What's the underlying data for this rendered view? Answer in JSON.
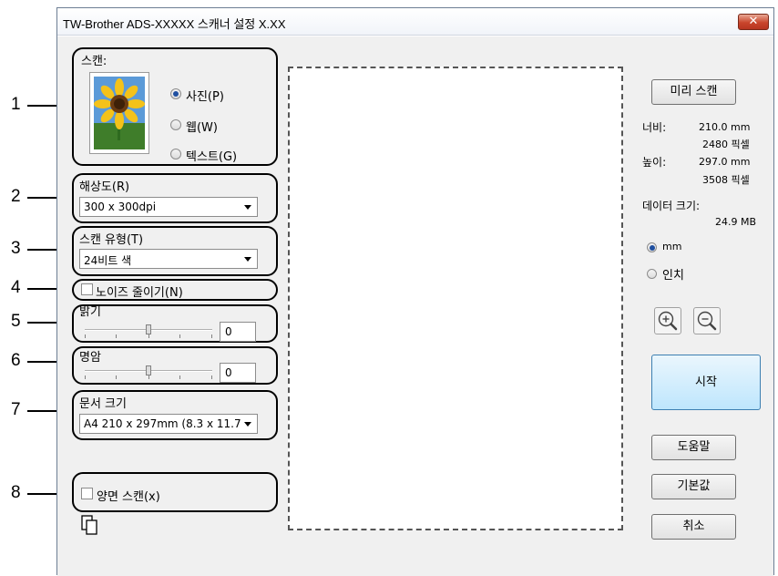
{
  "window": {
    "title": "TW-Brother ADS-XXXXX 스캐너 설정 X.XX",
    "close_glyph": "✕"
  },
  "callouts": [
    "1",
    "2",
    "3",
    "4",
    "5",
    "6",
    "7",
    "8"
  ],
  "scan_type_group": {
    "label": "스캔:",
    "options": [
      {
        "label": "사진(P)",
        "selected": true
      },
      {
        "label": "웹(W)",
        "selected": false
      },
      {
        "label": "텍스트(G)",
        "selected": false
      }
    ]
  },
  "resolution": {
    "label": "해상도(R)",
    "value": "300 x 300dpi"
  },
  "color_type": {
    "label": "스캔 유형(T)",
    "value": "24비트 색"
  },
  "noise_reduction": {
    "label": "노이즈 줄이기(N)",
    "checked": false
  },
  "brightness": {
    "label": "밝기",
    "value": "0",
    "level": 0
  },
  "contrast": {
    "label": "명암",
    "value": "0",
    "level": 0
  },
  "document_size": {
    "label": "문서 크기",
    "value": "A4 210 x 297mm (8.3 x 11.7"
  },
  "duplex": {
    "label": "양면 스캔(x)",
    "checked": false
  },
  "preview_button": "미리 스캔",
  "info": {
    "width_label": "너비:",
    "width_mm": "210.0 mm",
    "width_px": "2480 픽셀",
    "height_label": "높이:",
    "height_mm": "297.0 mm",
    "height_px": "3508 픽셀",
    "data_size_label": "데이터 크기:",
    "data_size_value": "24.9 MB"
  },
  "units": [
    {
      "label": "mm",
      "selected": true
    },
    {
      "label": "인치",
      "selected": false
    }
  ],
  "icons": {
    "zoom_in": "zoom-in-icon",
    "zoom_out": "zoom-out-icon",
    "duplex_pages": "duplex-pages-icon",
    "photo": "sunflower-photo-icon"
  },
  "buttons": {
    "start": "시작",
    "help": "도움말",
    "default": "기본값",
    "cancel": "취소"
  },
  "colors": {
    "accent_border": "#3c7fb1",
    "radio_selected": "#1f4fa0",
    "close_button": "#c9452c"
  }
}
